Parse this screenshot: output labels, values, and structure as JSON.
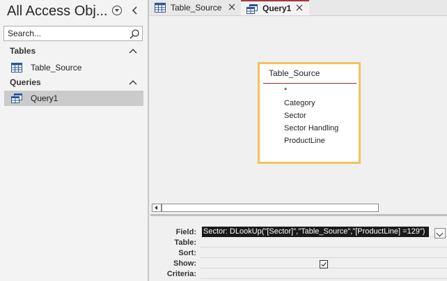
{
  "nav": {
    "title": "All Access Obj...",
    "search_placeholder": "Search...",
    "groups": [
      {
        "label": "Tables",
        "items": [
          {
            "label": "Table_Source",
            "icon": "table-icon"
          }
        ]
      },
      {
        "label": "Queries",
        "items": [
          {
            "label": "Query1",
            "icon": "query-icon",
            "selected": true
          }
        ]
      }
    ]
  },
  "tabs": [
    {
      "label": "Table_Source",
      "icon": "table-icon",
      "active": false
    },
    {
      "label": "Query1",
      "icon": "query-icon",
      "active": true
    }
  ],
  "table_box": {
    "title": "Table_Source",
    "fields": [
      "*",
      "Category",
      "Sector",
      "Sector Handling",
      "ProductLine"
    ]
  },
  "grid": {
    "row_labels": {
      "field": "Field:",
      "table": "Table:",
      "sort": "Sort:",
      "show": "Show:",
      "criteria": "Criteria:"
    },
    "field_value": "Sector: DLookUp(\"[Sector]\",\"Table_Source\",\"[ProductLine] =129\")",
    "show_checked": true
  },
  "colors": {
    "accent": "#a4373a",
    "table_box_border": "#f5c15c",
    "selected_item": "#cbcbcb"
  }
}
